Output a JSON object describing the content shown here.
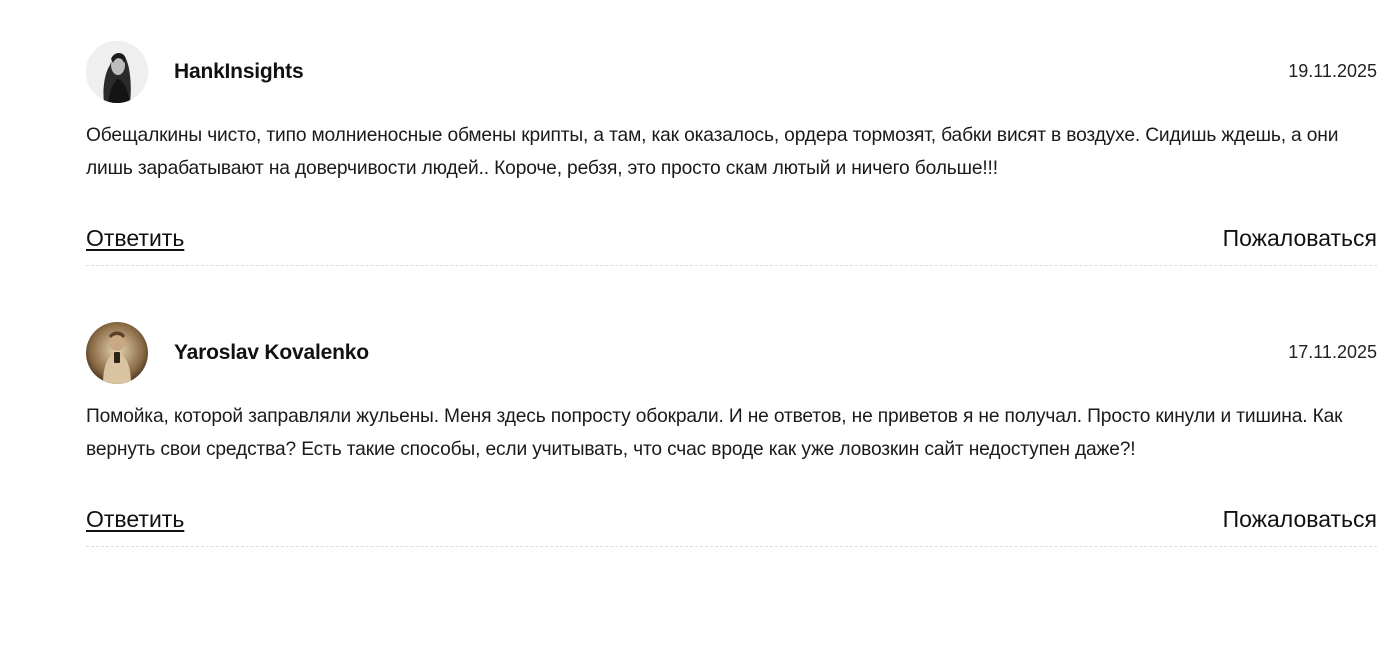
{
  "comments": [
    {
      "author": "HankInsights",
      "date": "19.11.2025",
      "text": "Обещалкины чисто, типо молниеносные обмены крипты, а там, как оказалось, ордера тормозят, бабки висят в воздухе. Сидишь ждешь, а они лишь зарабатывают на доверчивости людей.. Короче, ребзя, это просто скам лютый и ничего больше!!!",
      "reply_label": "Ответить",
      "report_label": "Пожаловаться"
    },
    {
      "author": "Yaroslav Kovalenko",
      "date": "17.11.2025",
      "text": "Помойка, которой заправляли жульены. Меня здесь попросту обокрали. И не ответов, не приветов я не получал. Просто кинули и тишина. Как вернуть свои средства? Есть такие способы, если учитывать, что счас вроде как уже ловозкин сайт недоступен даже?!",
      "reply_label": "Ответить",
      "report_label": "Пожаловаться"
    }
  ]
}
